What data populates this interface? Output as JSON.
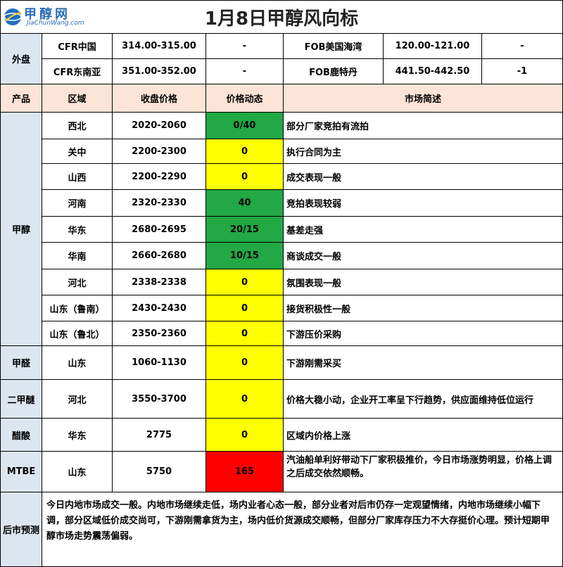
{
  "title": "1月8日甲醇风向标",
  "logo": {
    "name": "甲醇网",
    "url": "JiaChunWang.com"
  },
  "overseas": {
    "label": "外盘",
    "rows": [
      {
        "a_name": "CFR中国",
        "a_price": "314.00-315.00",
        "a_change": "-",
        "b_name": "FOB美国海湾",
        "b_price": "120.00-121.00",
        "b_change": "-"
      },
      {
        "a_name": "CFR东南亚",
        "a_price": "351.00-352.00",
        "a_change": "-",
        "b_name": "FOB鹿特丹",
        "b_price": "441.50-442.50",
        "b_change": "-1"
      }
    ]
  },
  "header": {
    "product": "产品",
    "region": "区域",
    "close_price": "收盘价格",
    "price_change": "价格动态",
    "market_desc": "市场简述"
  },
  "methanol": {
    "label": "甲醇",
    "rows": [
      {
        "region": "西北",
        "price": "2020-2060",
        "change": "0/40",
        "status": "green",
        "desc": "部分厂家竞拍有流拍"
      },
      {
        "region": "关中",
        "price": "2200-2300",
        "change": "0",
        "status": "yellow",
        "desc": "执行合同为主"
      },
      {
        "region": "山西",
        "price": "2200-2290",
        "change": "0",
        "status": "yellow",
        "desc": "成交表现一般"
      },
      {
        "region": "河南",
        "price": "2320-2330",
        "change": "40",
        "status": "green",
        "desc": "竞拍表现较弱"
      },
      {
        "region": "华东",
        "price": "2680-2695",
        "change": "20/15",
        "status": "green",
        "desc": "基差走强"
      },
      {
        "region": "华南",
        "price": "2660-2680",
        "change": "10/15",
        "status": "green",
        "desc": "商谈成交一般"
      },
      {
        "region": "河北",
        "price": "2338-2338",
        "change": "0",
        "status": "yellow",
        "desc": "氛围表现一般"
      },
      {
        "region": "山东（鲁南）",
        "price": "2430-2430",
        "change": "0",
        "status": "yellow",
        "desc": "接货积极性一般"
      },
      {
        "region": "山东（鲁北）",
        "price": "2350-2360",
        "change": "0",
        "status": "yellow",
        "desc": "下游压价采购"
      }
    ]
  },
  "others": [
    {
      "product": "甲醛",
      "region": "山东",
      "price": "1060-1130",
      "change": "0",
      "status": "yellow",
      "desc": "下游刚需采买"
    },
    {
      "product": "二甲醚",
      "region": "河北",
      "price": "3550-3700",
      "change": "0",
      "status": "yellow",
      "desc": "价格大稳小动，企业开工率呈下行趋势，供应面维持低位运行"
    },
    {
      "product": "醋酸",
      "region": "华东",
      "price": "2775",
      "change": "0",
      "status": "yellow",
      "desc": "区域内价格上涨"
    },
    {
      "product": "MTBE",
      "region": "山东",
      "price": "5750",
      "change": "165",
      "status": "red",
      "desc": "汽油船单利好带动下厂家积极推价，今日市场涨势明显，价格上调之后成交依然顺畅。"
    }
  ],
  "forecast": {
    "label": "后市预测",
    "text": "今日内地市场成交一般。内地市场继续走低，场内业者心态一般，部分业者对后市仍存一定观望情绪，内地市场继续小幅下调，部分区域低价成交尚可，下游刚需拿货为主，场内低价货源成交顺畅，但部分厂家库存压力不大存挺价心理。预计短期甲醇市场走势震荡偏弱。"
  },
  "colors": {
    "green": "#22a845",
    "yellow": "#ffff00",
    "red": "#ff0000",
    "label_bg": "#dce6f1",
    "header_bg": "#fce4d6"
  }
}
